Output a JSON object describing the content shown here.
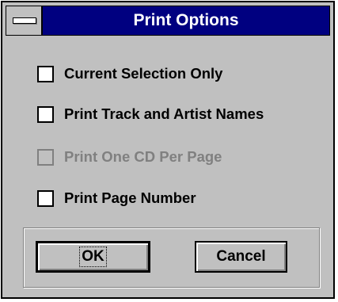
{
  "dialog": {
    "title": "Print Options",
    "options": [
      {
        "label": "Current Selection Only",
        "checked": false,
        "enabled": true
      },
      {
        "label": "Print Track and Artist Names",
        "checked": false,
        "enabled": true
      },
      {
        "label": "Print One CD Per Page",
        "checked": false,
        "enabled": false
      },
      {
        "label": "Print Page Number",
        "checked": false,
        "enabled": true
      }
    ],
    "buttons": {
      "ok_label": "OK",
      "cancel_label": "Cancel"
    }
  },
  "colors": {
    "titlebar": "#000080",
    "face": "#c0c0c0",
    "disabled_text": "#808080"
  },
  "icons": {
    "system_menu": "system-menu-icon"
  }
}
